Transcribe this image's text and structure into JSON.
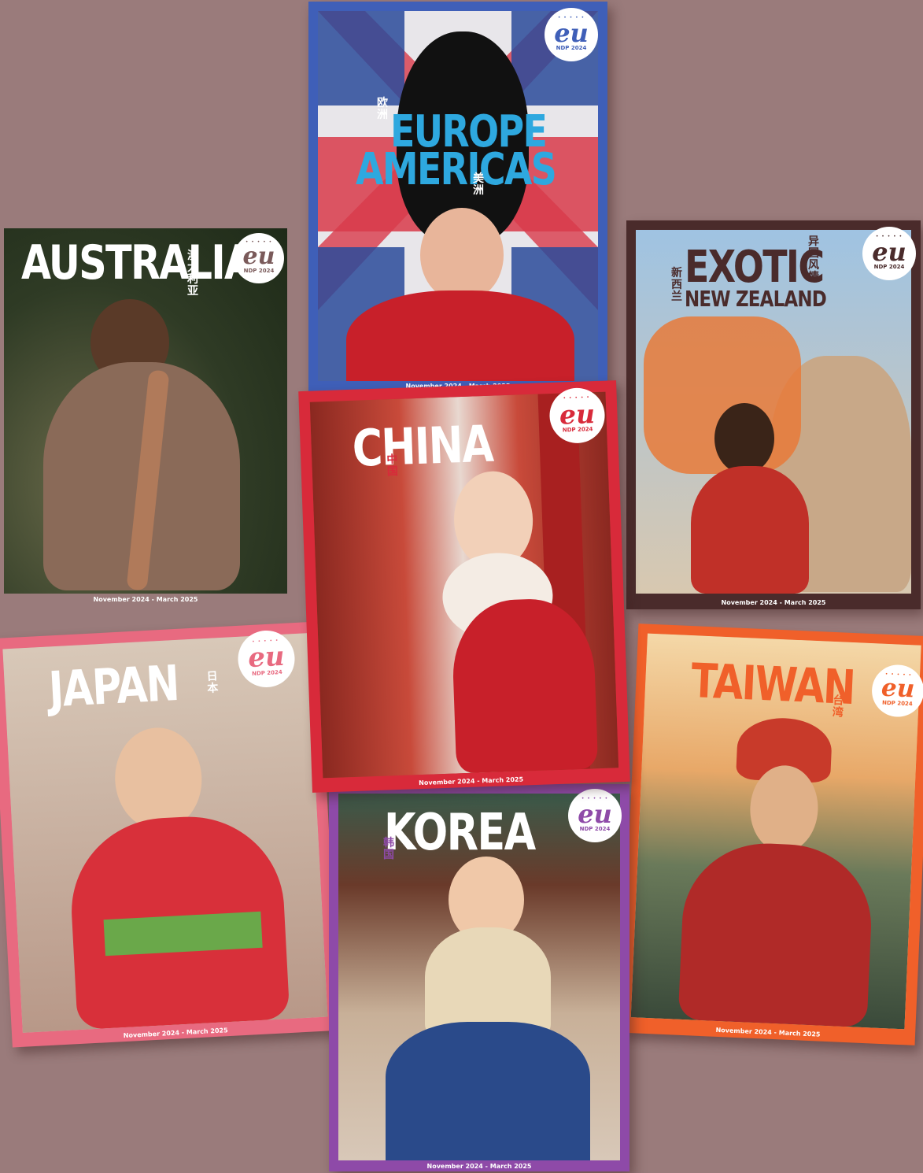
{
  "covers": {
    "europe": {
      "title_line1": "EUROPE",
      "title_line2": "AMERICAS",
      "cn1": "欧洲",
      "cn2": "美洲",
      "logo": "eu",
      "ndp": "NDP 2024",
      "footer": "November 2024 - March 2025",
      "frame_color": "#3f5fb8",
      "title_color": "#2ea8df"
    },
    "australia": {
      "title": "AUSTRALIA",
      "cn": "澳大利亚",
      "logo": "eu",
      "ndp": "NDP 2024",
      "footer": "November 2024 - March 2025",
      "frame_color": "#9a7b7b"
    },
    "nz": {
      "title_line1": "EXOTIC",
      "title_line2": "NEW ZEALAND",
      "cn1": "异国风情",
      "cn2": "新西兰",
      "logo": "eu",
      "ndp": "NDP 2024",
      "footer": "November 2024 - March 2025",
      "frame_color": "#4a2b2b",
      "title_color": "#4a2b2b"
    },
    "china": {
      "title": "CHINA",
      "cn": "中国",
      "logo": "eu",
      "ndp": "NDP 2024",
      "footer": "November 2024 - March 2025",
      "frame_color": "#d82a3a"
    },
    "japan": {
      "title": "JAPAN",
      "cn": "日本",
      "logo": "eu",
      "ndp": "NDP 2024",
      "footer": "November 2024 - March 2025",
      "frame_color": "#e86a80"
    },
    "taiwan": {
      "title": "TAIWAN",
      "cn": "台湾",
      "logo": "eu",
      "ndp": "NDP 2024",
      "footer": "November 2024 - March 2025",
      "frame_color": "#f0602a",
      "title_color": "#f0602a"
    },
    "korea": {
      "title": "KOREA",
      "cn": "韩国",
      "logo": "eu",
      "ndp": "NDP 2024",
      "footer": "November 2024 - March 2025",
      "frame_color": "#8e4aa8"
    }
  }
}
